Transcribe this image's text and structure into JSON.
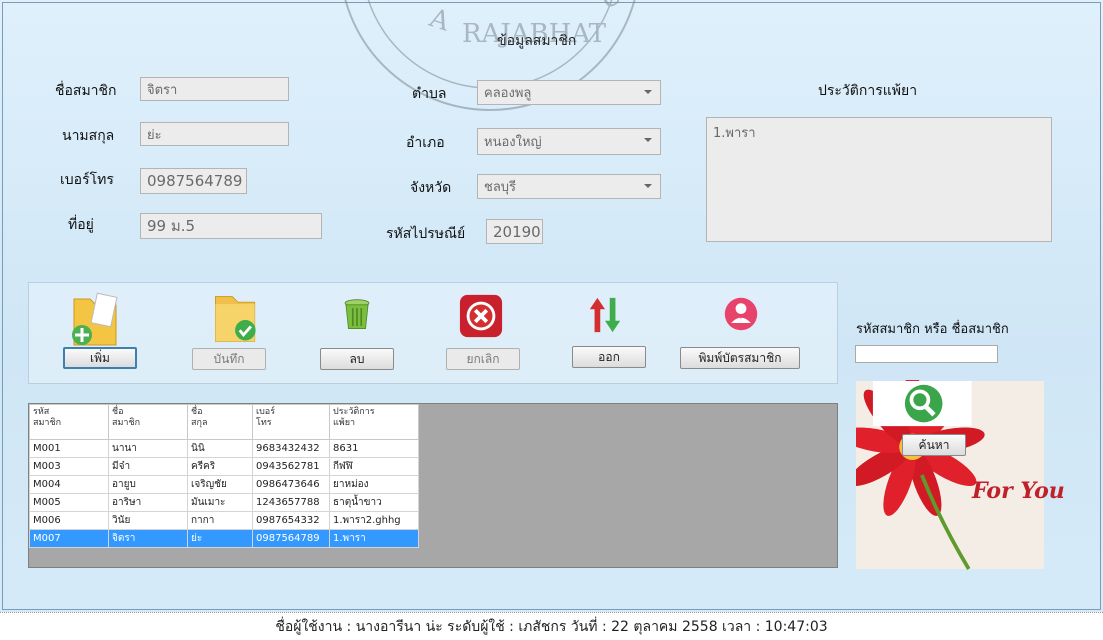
{
  "form": {
    "title": "ข้อมูลสมาชิก",
    "labels": {
      "first_name": "ชื่อสมาชิก",
      "last_name": "นามสกุล",
      "phone": "เบอร์โทร",
      "address": "ที่อยู่",
      "subdistrict": "ตำบล",
      "district": "อำเภอ",
      "province": "จังหวัด",
      "postcode": "รหัสไปรษณีย์",
      "allergy": "ประวัติการแพ้ยา"
    },
    "values": {
      "first_name": "จิตรา",
      "last_name": "ย่ะ",
      "phone": "0987564789",
      "address": "99 ม.5",
      "subdistrict": "คลองพลู",
      "district": "หนองใหญ่",
      "province": "ชลบุรี",
      "postcode": "20190",
      "allergy": "1.พารา"
    }
  },
  "toolbar": {
    "add": "เพิ่ม",
    "save": "บันทึก",
    "delete": "ลบ",
    "cancel": "ยกเลิก",
    "exit": "ออก",
    "print_card": "พิมพ์บัตรสมาชิก"
  },
  "search": {
    "label": "รหัสสมาชิก หรือ ชื่อสมาชิก",
    "value": "",
    "button": "ค้นหา",
    "banner_text": "For You"
  },
  "grid": {
    "headers": [
      [
        "รหัส",
        "สมาชิก"
      ],
      [
        "ชื่อ",
        "สมาชิก"
      ],
      [
        "ชื่อ",
        "สกุล"
      ],
      [
        "เบอร์",
        "โทร"
      ],
      [
        "ประวัติการ",
        "แพ้ยา"
      ]
    ],
    "rows": [
      [
        "M001",
        "นานา",
        "นินิ",
        "9683432432",
        "8631"
      ],
      [
        "M003",
        "มีจ๋า",
        "ครีคริ",
        "0943562781",
        "กีฬฬิ"
      ],
      [
        "M004",
        "อายูบ",
        "เจริญชัย",
        "0986473646",
        "ยาหม่อง"
      ],
      [
        "M005",
        "อาริษา",
        "มันเมาะ",
        "1243657788",
        "ธาตุน้ำขาว"
      ],
      [
        "M006",
        "วินัย",
        "กากา",
        "0987654332",
        "1.พารา2.ghhg"
      ],
      [
        "M007",
        "จิตรา",
        "ย่ะ",
        "0987564789",
        "1.พารา"
      ]
    ],
    "selected_index": 5
  },
  "status": {
    "text": "ชื่อผู้ใช้งาน : นางอารีนา   น่ะ   ระดับผู้ใช้ : เภสัชกร   วันที่ : 22 ตุลาคม 2558  เวลา : 10:47:03"
  },
  "colors": {
    "background": "#d6ebf8",
    "selected_row": "#3399ff",
    "add_icon": "#4caf50",
    "cancel_icon": "#d32f2f",
    "print_icon": "#e8436a",
    "search_icon": "#3aa54a"
  }
}
